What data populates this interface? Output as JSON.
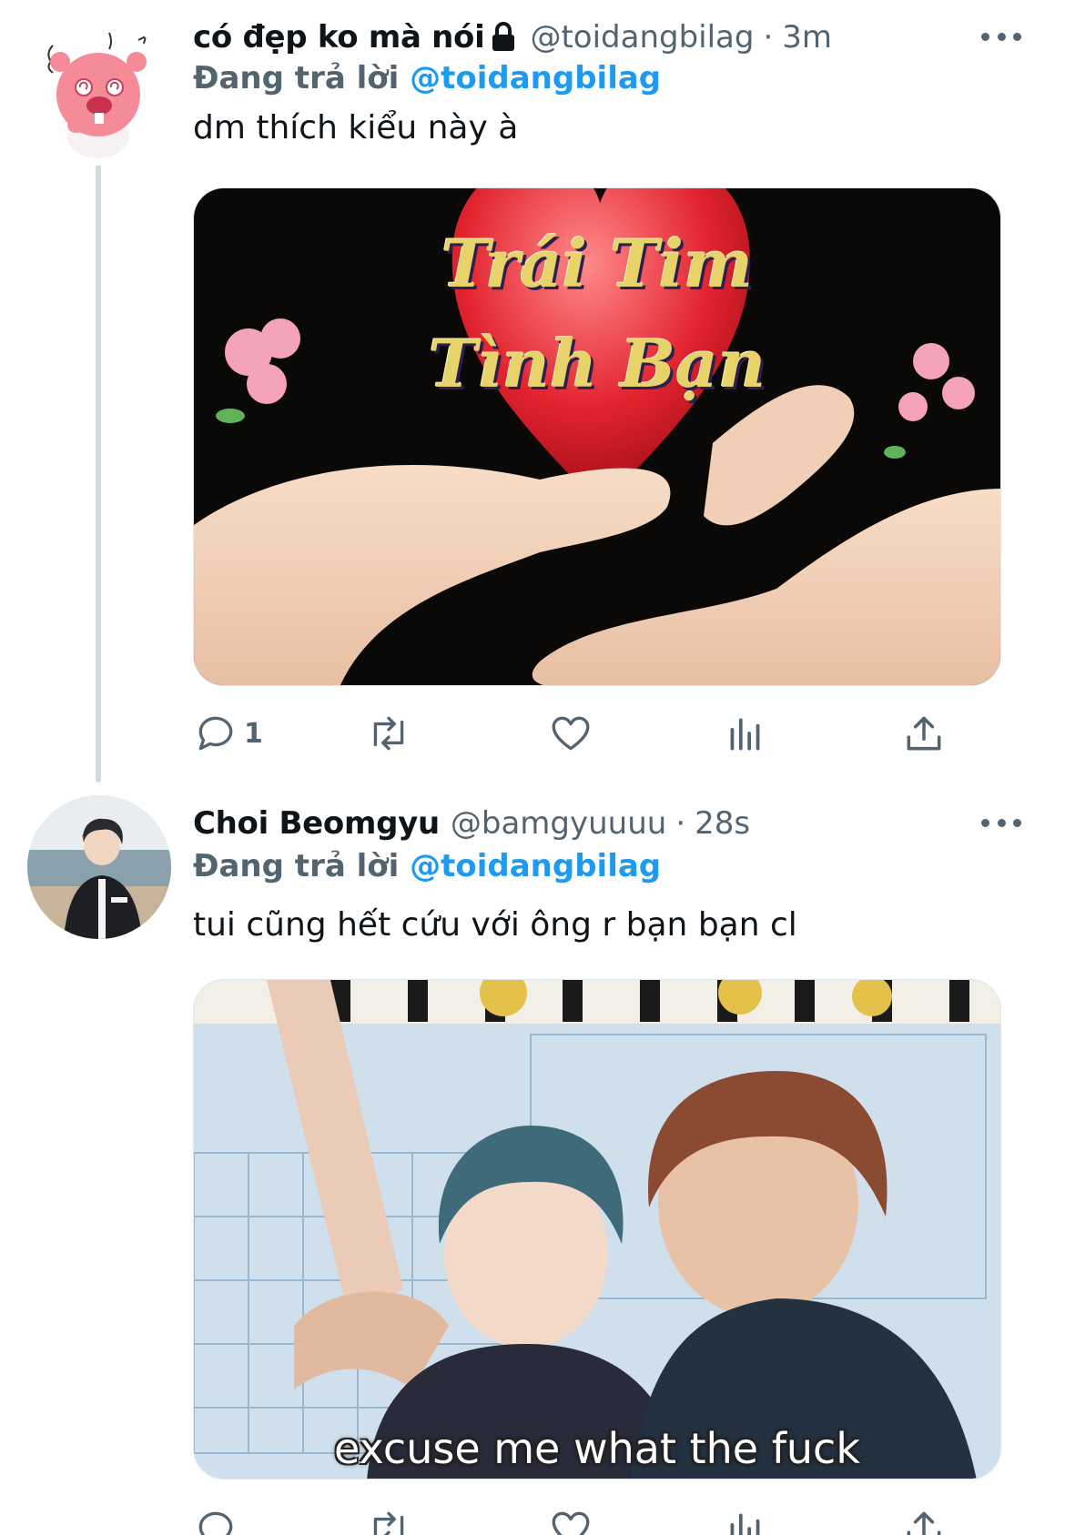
{
  "colors": {
    "accent": "#1d9bf0",
    "secondary_text": "#536471",
    "primary_text": "#0f1419",
    "thread_line": "#cfd9de"
  },
  "tweets": [
    {
      "display_name": "có đẹp ko mà nói",
      "protected_icon": "lock-icon",
      "handle": "@toidangbilag",
      "separator": "·",
      "time": "3m",
      "reply_prefix": "Đang trả lời",
      "reply_mention": "@toidangbilag",
      "text": "dm thích kiểu này à",
      "media": {
        "title_line1": "Trái Tim",
        "title_line2": "Tình Bạn"
      },
      "actions": {
        "reply_count": "1",
        "retweet_count": "",
        "like_count": "",
        "stats_count": ""
      }
    },
    {
      "display_name": "Choi Beomgyu",
      "handle": "@bamgyuuuu",
      "separator": "·",
      "time": "28s",
      "reply_prefix": "Đang trả lời",
      "reply_mention": "@toidangbilag",
      "text": "tui cũng hết cứu với ông r bạn bạn cl",
      "media": {
        "caption": "excuse me what the fuck"
      },
      "actions": {
        "reply_count": "",
        "retweet_count": "",
        "like_count": "",
        "stats_count": ""
      }
    }
  ]
}
